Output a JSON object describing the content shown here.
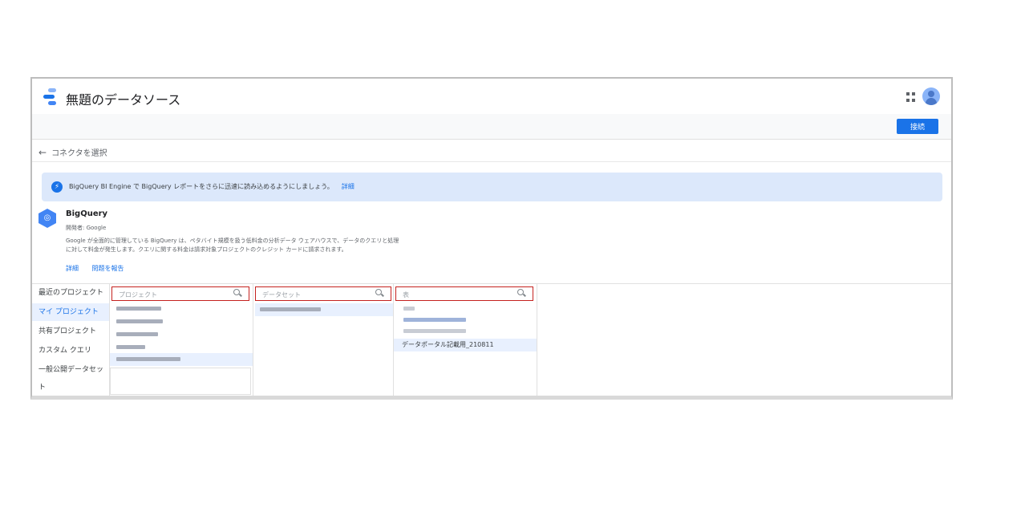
{
  "header": {
    "title": "無題のデータソース",
    "logo_colors": [
      "#1a73e8",
      "#4285f4",
      "#8ab4f8"
    ]
  },
  "toolbar": {
    "connect_label": "接続"
  },
  "nav": {
    "back_label": "コネクタを選択"
  },
  "banner": {
    "text": "BigQuery BI Engine で BigQuery レポートをさらに迅速に読み込めるようにしましょう。",
    "link": "詳細"
  },
  "connector": {
    "name": "BigQuery",
    "developer": "開発者: Google",
    "description_line1": "Google が全面的に管理している BigQuery は、ペタバイト規模を扱う低料金の分析データ ウェアハウスで、データのクエリと処理",
    "description_line2": "に対して料金が発生します。クエリに関する料金は請求対象プロジェクトのクレジット カードに請求されます。",
    "links": [
      "詳細",
      "問題を報告"
    ]
  },
  "sidebar": {
    "items": [
      {
        "label": "最近のプロジェクト",
        "active": false
      },
      {
        "label": "マイ プロジェクト",
        "active": true
      },
      {
        "label": "共有プロジェクト",
        "active": false
      },
      {
        "label": "カスタム クエリ",
        "active": false
      },
      {
        "label": "一般公開データセット",
        "active": false
      }
    ]
  },
  "columns": {
    "projects": {
      "placeholder": "プロジェクト"
    },
    "datasets": {
      "placeholder": "データセット"
    },
    "tables": {
      "placeholder": "表",
      "visible_row": "データポータル記載用_210811"
    }
  },
  "colors": {
    "accent": "#1a73e8",
    "highlight_border": "#c5221f",
    "banner_bg": "#dce8fb",
    "selected_row": "#e8f0fe"
  }
}
